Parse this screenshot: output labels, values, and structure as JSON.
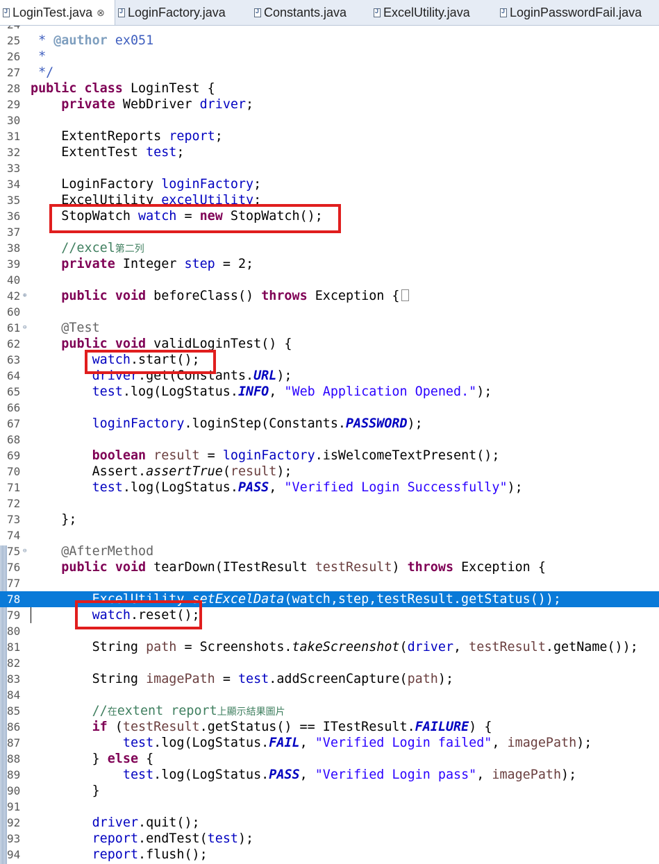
{
  "tabs": [
    {
      "label": "LoginTest.java",
      "active": true,
      "close": "⊗"
    },
    {
      "label": "LoginFactory.java",
      "active": false
    },
    {
      "label": "Constants.java",
      "active": false
    },
    {
      "label": "ExcelUtility.java",
      "active": false
    },
    {
      "label": "LoginPasswordFail.java",
      "active": false
    }
  ],
  "colors": {
    "highlight": "#0a7ad8",
    "callout": "#e01e1e",
    "keyword": "#7f0055"
  },
  "lines": [
    {
      "n": "24",
      "t": [
        [
          "jd",
          "*"
        ]
      ]
    },
    {
      "n": "25",
      "t": [
        [
          "jd",
          " * "
        ],
        [
          "jdtag",
          "@author"
        ],
        [
          "jd",
          " ex051"
        ]
      ]
    },
    {
      "n": "26",
      "t": [
        [
          "jd",
          " *"
        ]
      ]
    },
    {
      "n": "27",
      "t": [
        [
          "jd",
          " */"
        ]
      ]
    },
    {
      "n": "28",
      "t": [
        [
          "kw",
          "public"
        ],
        [
          "",
          " "
        ],
        [
          "kw",
          "class"
        ],
        [
          "",
          " LoginTest {"
        ]
      ]
    },
    {
      "n": "29",
      "t": [
        [
          "",
          "    "
        ],
        [
          "kw",
          "private"
        ],
        [
          "",
          " WebDriver "
        ],
        [
          "fld",
          "driver"
        ],
        [
          "",
          ";"
        ]
      ]
    },
    {
      "n": "30",
      "t": []
    },
    {
      "n": "31",
      "t": [
        [
          "",
          "    ExtentReports "
        ],
        [
          "fld",
          "report"
        ],
        [
          "",
          ";"
        ]
      ]
    },
    {
      "n": "32",
      "t": [
        [
          "",
          "    ExtentTest "
        ],
        [
          "fld",
          "test"
        ],
        [
          "",
          ";"
        ]
      ]
    },
    {
      "n": "33",
      "t": []
    },
    {
      "n": "34",
      "t": [
        [
          "",
          "    LoginFactory "
        ],
        [
          "fld",
          "loginFactory"
        ],
        [
          "",
          ";"
        ]
      ]
    },
    {
      "n": "35",
      "t": [
        [
          "",
          "    ExcelUtility "
        ],
        [
          "fld",
          "excelUtility"
        ],
        [
          "",
          ";"
        ]
      ]
    },
    {
      "n": "36",
      "t": [
        [
          "",
          "    StopWatch "
        ],
        [
          "fld",
          "watch"
        ],
        [
          "",
          " = "
        ],
        [
          "kw",
          "new"
        ],
        [
          "",
          " StopWatch();"
        ]
      ]
    },
    {
      "n": "37",
      "t": []
    },
    {
      "n": "38",
      "t": [
        [
          "cmt",
          "    //excel"
        ],
        [
          "cmt cjk",
          "第二列"
        ]
      ]
    },
    {
      "n": "39",
      "t": [
        [
          "",
          "    "
        ],
        [
          "kw",
          "private"
        ],
        [
          "",
          " Integer "
        ],
        [
          "fld",
          "step"
        ],
        [
          "",
          " = 2;"
        ]
      ]
    },
    {
      "n": "40",
      "t": []
    },
    {
      "n": "42",
      "fold": "⊕",
      "collapsed": true,
      "t": [
        [
          "",
          "    "
        ],
        [
          "kw",
          "public"
        ],
        [
          "",
          " "
        ],
        [
          "kw",
          "void"
        ],
        [
          "",
          " beforeClass() "
        ],
        [
          "kw",
          "throws"
        ],
        [
          "",
          " Exception {"
        ]
      ]
    },
    {
      "n": "60",
      "t": []
    },
    {
      "n": "61",
      "fold": "⊖",
      "t": [
        [
          "ann",
          "    @Test"
        ]
      ]
    },
    {
      "n": "62",
      "t": [
        [
          "",
          "    "
        ],
        [
          "kw",
          "public"
        ],
        [
          "",
          " "
        ],
        [
          "kw",
          "void"
        ],
        [
          "",
          " validLoginTest() {"
        ]
      ]
    },
    {
      "n": "63",
      "t": [
        [
          "",
          "        "
        ],
        [
          "fld",
          "watch"
        ],
        [
          "",
          ".start();"
        ]
      ]
    },
    {
      "n": "64",
      "t": [
        [
          "",
          "        "
        ],
        [
          "fld",
          "driver"
        ],
        [
          "",
          ".get(Constants."
        ],
        [
          "sfld",
          "URL"
        ],
        [
          "",
          ");"
        ]
      ]
    },
    {
      "n": "65",
      "t": [
        [
          "",
          "        "
        ],
        [
          "fld",
          "test"
        ],
        [
          "",
          ".log(LogStatus."
        ],
        [
          "sfld",
          "INFO"
        ],
        [
          "",
          ", "
        ],
        [
          "str",
          "\"Web Application Opened.\""
        ],
        [
          "",
          ");"
        ]
      ]
    },
    {
      "n": "66",
      "t": []
    },
    {
      "n": "67",
      "t": [
        [
          "",
          "        "
        ],
        [
          "fld",
          "loginFactory"
        ],
        [
          "",
          ".loginStep(Constants."
        ],
        [
          "sfld",
          "PASSWORD"
        ],
        [
          "",
          ");"
        ]
      ]
    },
    {
      "n": "68",
      "t": []
    },
    {
      "n": "69",
      "t": [
        [
          "",
          "        "
        ],
        [
          "kw",
          "boolean"
        ],
        [
          "",
          " "
        ],
        [
          "par",
          "result"
        ],
        [
          "",
          " = "
        ],
        [
          "fld",
          "loginFactory"
        ],
        [
          "",
          ".isWelcomeTextPresent();"
        ]
      ]
    },
    {
      "n": "70",
      "t": [
        [
          "",
          "        Assert."
        ],
        [
          "mth",
          "assertTrue"
        ],
        [
          "",
          "("
        ],
        [
          "par",
          "result"
        ],
        [
          "",
          ");"
        ]
      ]
    },
    {
      "n": "71",
      "t": [
        [
          "",
          "        "
        ],
        [
          "fld",
          "test"
        ],
        [
          "",
          ".log(LogStatus."
        ],
        [
          "sfld",
          "PASS"
        ],
        [
          "",
          ", "
        ],
        [
          "str",
          "\"Verified Login Successfully\""
        ],
        [
          "",
          ");"
        ]
      ]
    },
    {
      "n": "72",
      "t": []
    },
    {
      "n": "73",
      "t": [
        [
          "",
          "    };"
        ]
      ]
    },
    {
      "n": "74",
      "t": []
    },
    {
      "n": "75",
      "fold": "⊖",
      "t": [
        [
          "ann",
          "    @AfterMethod"
        ]
      ]
    },
    {
      "n": "76",
      "t": [
        [
          "",
          "    "
        ],
        [
          "kw",
          "public"
        ],
        [
          "",
          " "
        ],
        [
          "kw",
          "void"
        ],
        [
          "",
          " tearDown(ITestResult "
        ],
        [
          "par",
          "testResult"
        ],
        [
          "",
          ") "
        ],
        [
          "kw",
          "throws"
        ],
        [
          "",
          " Exception {"
        ]
      ]
    },
    {
      "n": "77",
      "t": []
    },
    {
      "n": "78",
      "highlight": true,
      "t": [
        [
          "",
          "        ExcelUtility."
        ],
        [
          "mth",
          "setExcelData"
        ],
        [
          "",
          "(watch,step,testResult.getStatus());"
        ]
      ]
    },
    {
      "n": "79",
      "cursor": true,
      "t": [
        [
          "",
          "        "
        ],
        [
          "fld",
          "watch"
        ],
        [
          "",
          ".reset();"
        ]
      ]
    },
    {
      "n": "80",
      "t": []
    },
    {
      "n": "81",
      "t": [
        [
          "",
          "        String "
        ],
        [
          "par",
          "path"
        ],
        [
          "",
          " = Screenshots."
        ],
        [
          "mth",
          "takeScreenshot"
        ],
        [
          "",
          "("
        ],
        [
          "fld",
          "driver"
        ],
        [
          "",
          ", "
        ],
        [
          "par",
          "testResult"
        ],
        [
          "",
          ".getName());"
        ]
      ]
    },
    {
      "n": "82",
      "t": []
    },
    {
      "n": "83",
      "t": [
        [
          "",
          "        String "
        ],
        [
          "par",
          "imagePath"
        ],
        [
          "",
          " = "
        ],
        [
          "fld",
          "test"
        ],
        [
          "",
          ".addScreenCapture("
        ],
        [
          "par",
          "path"
        ],
        [
          "",
          ");"
        ]
      ]
    },
    {
      "n": "84",
      "t": []
    },
    {
      "n": "85",
      "t": [
        [
          "cmt",
          "        //"
        ],
        [
          "cmt cjk",
          "在"
        ],
        [
          "cmt",
          "extent report"
        ],
        [
          "cmt cjk",
          "上顯示結果圖片"
        ]
      ]
    },
    {
      "n": "86",
      "t": [
        [
          "",
          "        "
        ],
        [
          "kw",
          "if"
        ],
        [
          "",
          " ("
        ],
        [
          "par",
          "testResult"
        ],
        [
          "",
          ".getStatus() == ITestResult."
        ],
        [
          "sfld",
          "FAILURE"
        ],
        [
          "",
          ") {"
        ]
      ]
    },
    {
      "n": "87",
      "t": [
        [
          "",
          "            "
        ],
        [
          "fld",
          "test"
        ],
        [
          "",
          ".log(LogStatus."
        ],
        [
          "sfld",
          "FAIL"
        ],
        [
          "",
          ", "
        ],
        [
          "str",
          "\"Verified Login failed\""
        ],
        [
          "",
          ", "
        ],
        [
          "par",
          "imagePath"
        ],
        [
          "",
          ");"
        ]
      ]
    },
    {
      "n": "88",
      "t": [
        [
          "",
          "        } "
        ],
        [
          "kw",
          "else"
        ],
        [
          "",
          " {"
        ]
      ]
    },
    {
      "n": "89",
      "t": [
        [
          "",
          "            "
        ],
        [
          "fld",
          "test"
        ],
        [
          "",
          ".log(LogStatus."
        ],
        [
          "sfld",
          "PASS"
        ],
        [
          "",
          ", "
        ],
        [
          "str",
          "\"Verified Login pass\""
        ],
        [
          "",
          ", "
        ],
        [
          "par",
          "imagePath"
        ],
        [
          "",
          ");"
        ]
      ]
    },
    {
      "n": "90",
      "t": [
        [
          "",
          "        }"
        ]
      ]
    },
    {
      "n": "91",
      "t": []
    },
    {
      "n": "92",
      "t": [
        [
          "",
          "        "
        ],
        [
          "fld",
          "driver"
        ],
        [
          "",
          ".quit();"
        ]
      ]
    },
    {
      "n": "93",
      "t": [
        [
          "",
          "        "
        ],
        [
          "fld",
          "report"
        ],
        [
          "",
          ".endTest("
        ],
        [
          "fld",
          "test"
        ],
        [
          "",
          ");"
        ]
      ]
    },
    {
      "n": "94",
      "t": [
        [
          "",
          "        "
        ],
        [
          "fld",
          "report"
        ],
        [
          "",
          ".flush();"
        ]
      ]
    }
  ]
}
